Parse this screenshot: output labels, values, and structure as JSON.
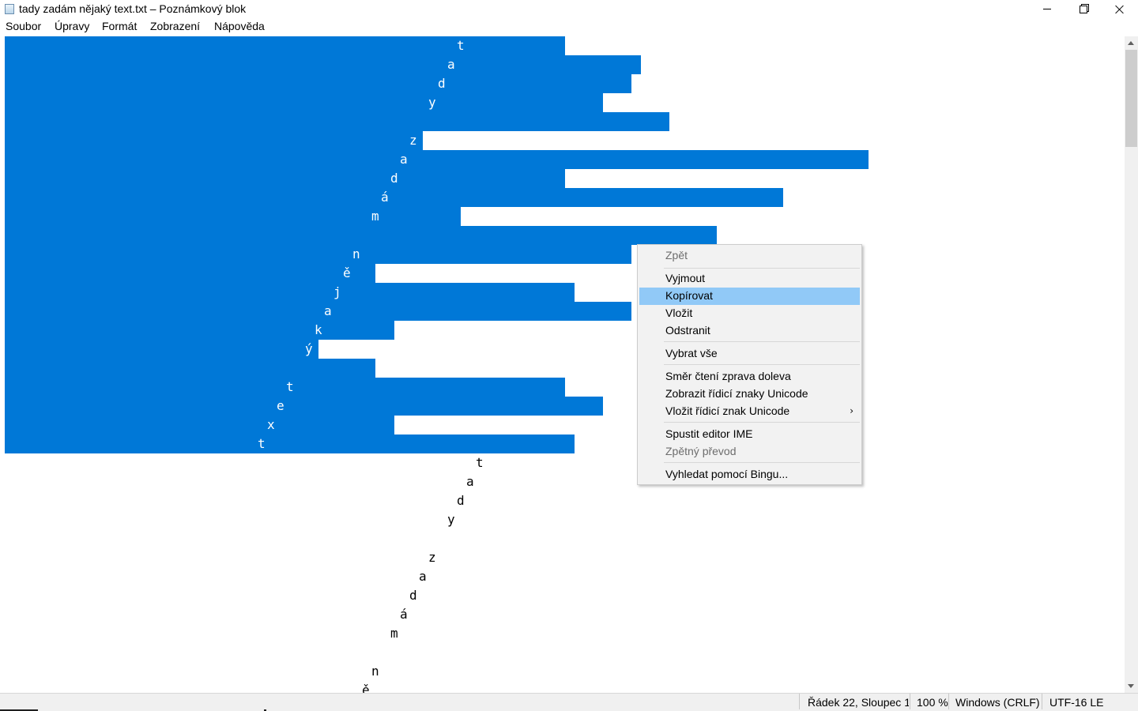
{
  "window": {
    "title": "tady zadám nějaký text.txt – Poznámkový blok",
    "controls": [
      "minimize",
      "maximize-restore",
      "close"
    ]
  },
  "menubar": [
    "Soubor",
    "Úpravy",
    "Formát",
    "Zobrazení",
    "Nápověda"
  ],
  "editor": {
    "selected_lines": [
      "t",
      "a",
      "d",
      "y",
      "",
      "z",
      "a",
      "d",
      "á",
      "m",
      "",
      "n",
      "ě",
      "j",
      "a",
      "k",
      "ý",
      "",
      "t",
      "e",
      "x",
      "t"
    ],
    "unselected_lines": [
      "t",
      "a",
      "d",
      "y",
      "",
      "z",
      "a",
      "d",
      "á",
      "m",
      "",
      "n",
      "ě"
    ]
  },
  "context_menu": {
    "items": [
      {
        "label": "Zpět",
        "enabled": false
      },
      {
        "label": "Vyjmout",
        "enabled": true
      },
      {
        "label": "Kopírovat",
        "enabled": true,
        "highlighted": true
      },
      {
        "label": "Vložit",
        "enabled": true
      },
      {
        "label": "Odstranit",
        "enabled": true
      },
      {
        "label": "Vybrat vše",
        "enabled": true
      },
      {
        "label": "Směr čtení zprava doleva",
        "enabled": true
      },
      {
        "label": "Zobrazit řídicí znaky Unicode",
        "enabled": true
      },
      {
        "label": "Vložit řídicí znak Unicode",
        "enabled": true,
        "submenu": true
      },
      {
        "label": "Spustit editor IME",
        "enabled": true
      },
      {
        "label": "Zpětný převod",
        "enabled": false
      },
      {
        "label": "Vyhledat pomocí Bingu...",
        "enabled": true
      }
    ],
    "submenu_arrow": "›"
  },
  "statusbar": {
    "position": "Řádek 22, Sloupec 1",
    "zoom": "100 %",
    "line_ending": "Windows (CRLF)",
    "encoding": "UTF-16 LE"
  },
  "colors": {
    "selection": "#0078d7",
    "menu_highlight": "#91c9f7",
    "menu_background": "#f2f2f2",
    "statusbar_background": "#f0f0f0"
  }
}
